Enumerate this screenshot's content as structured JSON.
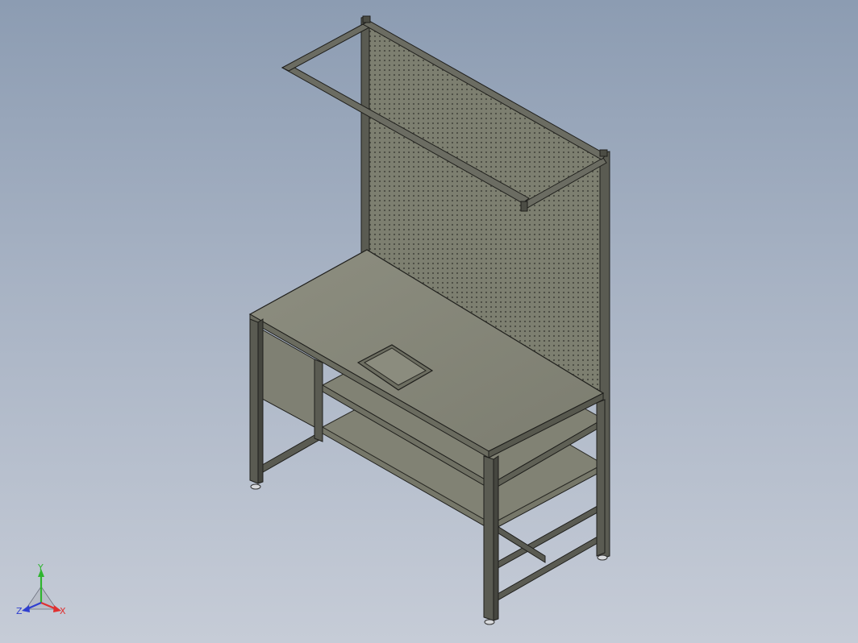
{
  "scene": {
    "description_visible_text": "",
    "background_top": "#8c9cb2",
    "background_bottom": "#c6ccd7"
  },
  "triad": {
    "x_label": "X",
    "y_label": "Y",
    "z_label": "Z",
    "x_color": "#e03030",
    "y_color": "#2fb52f",
    "z_color": "#2f3fd0"
  }
}
